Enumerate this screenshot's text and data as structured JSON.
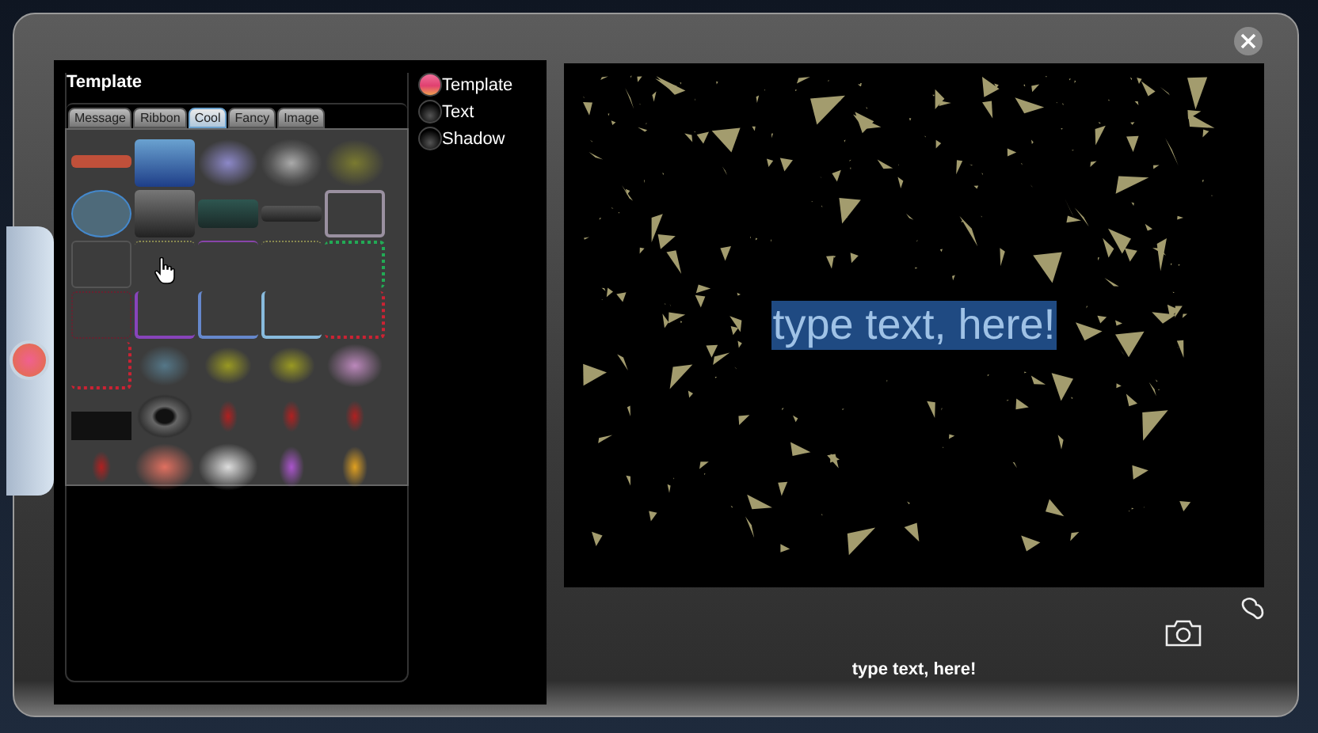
{
  "template_panel": {
    "title": "Template",
    "tabs": [
      {
        "label": "Message",
        "selected": false
      },
      {
        "label": "Ribbon",
        "selected": false
      },
      {
        "label": "Cool",
        "selected": true
      },
      {
        "label": "Fancy",
        "selected": false
      },
      {
        "label": "Image",
        "selected": false
      }
    ]
  },
  "layers": [
    {
      "label": "Template",
      "selected": true
    },
    {
      "label": "Text",
      "selected": false
    },
    {
      "label": "Shadow",
      "selected": false
    }
  ],
  "preview": {
    "text": "type text, here!",
    "text_selected": true
  },
  "caption": "type text, here!"
}
